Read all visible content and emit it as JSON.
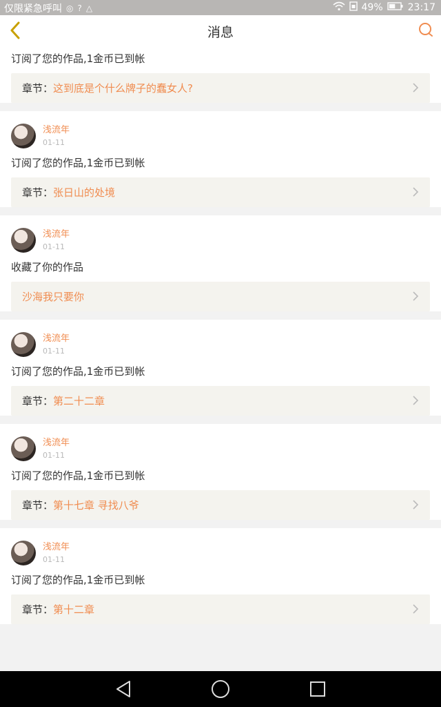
{
  "status_bar": {
    "carrier": "仅限紧急呼叫",
    "battery": "49%",
    "time": "23:17"
  },
  "header": {
    "title": "消息"
  },
  "messages": [
    {
      "action": "订阅了您的作品,1金币已到帐",
      "chapter_label": "章节：",
      "chapter_value": "这到底是个什么牌子的蠢女人?"
    },
    {
      "user": "浅流年",
      "date": "01-11",
      "action": "订阅了您的作品,1金币已到帐",
      "chapter_label": "章节：",
      "chapter_value": "张日山的处境"
    },
    {
      "user": "浅流年",
      "date": "01-11",
      "action": "收藏了你的作品",
      "chapter_label": "",
      "chapter_value": "沙海我只要你"
    },
    {
      "user": "浅流年",
      "date": "01-11",
      "action": "订阅了您的作品,1金币已到帐",
      "chapter_label": "章节：",
      "chapter_value": "第二十二章"
    },
    {
      "user": "浅流年",
      "date": "01-11",
      "action": "订阅了您的作品,1金币已到帐",
      "chapter_label": "章节：",
      "chapter_value": "第十七章 寻找八爷"
    },
    {
      "user": "浅流年",
      "date": "01-11",
      "action": "订阅了您的作品,1金币已到帐",
      "chapter_label": "章节：",
      "chapter_value": "第十二章"
    }
  ],
  "colors": {
    "accent": "#f08c50",
    "chapter_bg": "#f4f3ee"
  }
}
